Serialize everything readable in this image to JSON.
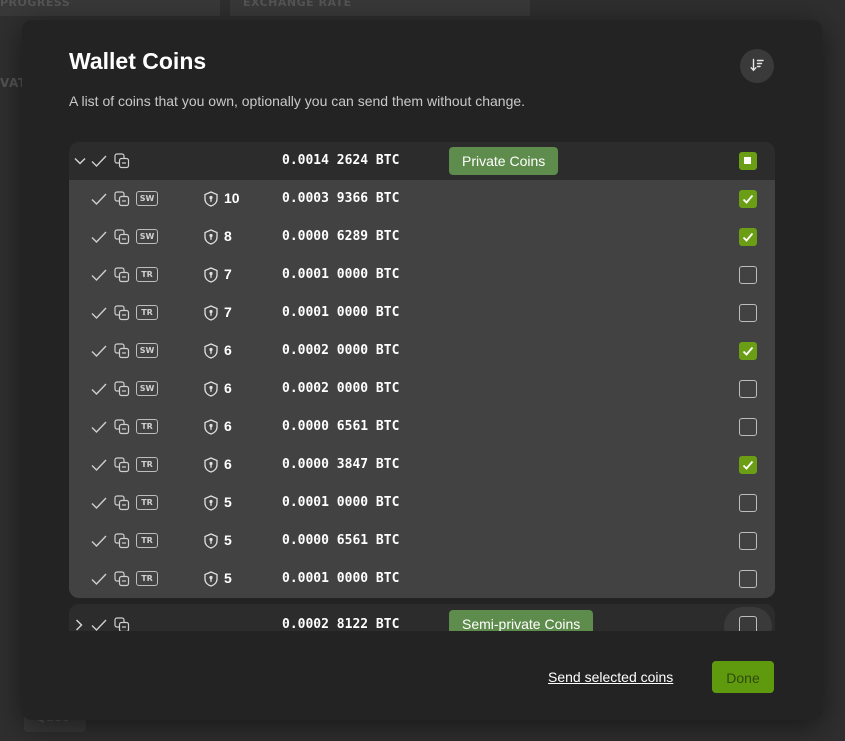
{
  "background": {
    "col_progress": "PROGRESS",
    "col_exchange_rate": "EXCHANGE RATE",
    "side_text": "VAT",
    "bottom_text": "Quoc"
  },
  "modal": {
    "title": "Wallet Coins",
    "subtitle": "A list of coins that you own, optionally you can send them without change.",
    "sort_icon": "sort-descending-icon"
  },
  "groups": [
    {
      "amount": "0.0014 2624 BTC",
      "label": "Private Coins",
      "expanded": true,
      "checkbox_state": "indeterminate"
    },
    {
      "amount": "0.0002 8122 BTC",
      "label": "Semi-private Coins",
      "expanded": false,
      "checkbox_state": "unchecked"
    }
  ],
  "coins": [
    {
      "script": "SW",
      "anon": "10",
      "amount": "0.0003 9366 BTC",
      "checked": true
    },
    {
      "script": "SW",
      "anon": "8",
      "amount": "0.0000 6289 BTC",
      "checked": true
    },
    {
      "script": "TR",
      "anon": "7",
      "amount": "0.0001 0000 BTC",
      "checked": false
    },
    {
      "script": "TR",
      "anon": "7",
      "amount": "0.0001 0000 BTC",
      "checked": false
    },
    {
      "script": "SW",
      "anon": "6",
      "amount": "0.0002 0000 BTC",
      "checked": true
    },
    {
      "script": "SW",
      "anon": "6",
      "amount": "0.0002 0000 BTC",
      "checked": false
    },
    {
      "script": "TR",
      "anon": "6",
      "amount": "0.0000 6561 BTC",
      "checked": false
    },
    {
      "script": "TR",
      "anon": "6",
      "amount": "0.0000 3847 BTC",
      "checked": true
    },
    {
      "script": "TR",
      "anon": "5",
      "amount": "0.0001 0000 BTC",
      "checked": false
    },
    {
      "script": "TR",
      "anon": "5",
      "amount": "0.0000 6561 BTC",
      "checked": false
    },
    {
      "script": "TR",
      "anon": "5",
      "amount": "0.0001 0000 BTC",
      "checked": false
    }
  ],
  "footer": {
    "send_label": "Send selected coins",
    "done_label": "Done"
  },
  "colors": {
    "accent_green": "#6b9e14",
    "label_green": "#5e8c4c",
    "modal_bg": "#232323",
    "row_bg": "#424242"
  }
}
